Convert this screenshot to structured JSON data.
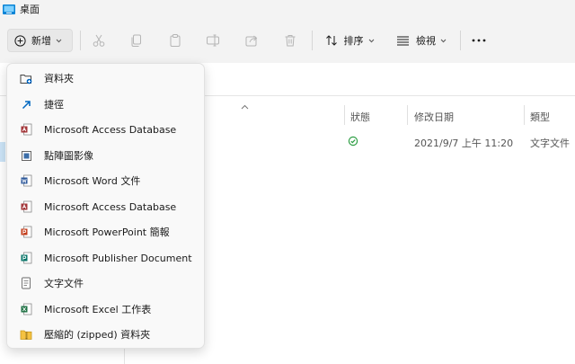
{
  "window": {
    "title": "桌面"
  },
  "toolbar": {
    "new_label": "新增",
    "sort_label": "排序",
    "view_label": "檢視"
  },
  "menu": {
    "items": [
      {
        "label": "資料夾",
        "icon": "folder-new-icon"
      },
      {
        "label": "捷徑",
        "icon": "shortcut-icon"
      },
      {
        "label": "Microsoft Access Database",
        "icon": "access-icon"
      },
      {
        "label": "點陣圖影像",
        "icon": "bitmap-icon"
      },
      {
        "label": "Microsoft Word 文件",
        "icon": "word-icon"
      },
      {
        "label": "Microsoft Access Database",
        "icon": "access-icon"
      },
      {
        "label": "Microsoft PowerPoint 簡報",
        "icon": "powerpoint-icon"
      },
      {
        "label": "Microsoft Publisher Document",
        "icon": "publisher-icon"
      },
      {
        "label": "文字文件",
        "icon": "text-document-icon"
      },
      {
        "label": "Microsoft Excel 工作表",
        "icon": "excel-icon"
      },
      {
        "label": "壓縮的 (zipped) 資料夾",
        "icon": "zip-folder-icon"
      }
    ]
  },
  "columns": {
    "status": "狀態",
    "modified": "修改日期",
    "type": "類型"
  },
  "file_row": {
    "modified": "2021/9/7 上午 11:20",
    "type": "文字文件"
  },
  "colors": {
    "accent": "#0067c0",
    "chrome": "#f3f3f3",
    "status_ok": "#2e9e44",
    "word": "#2b579a",
    "excel": "#217346",
    "powerpoint": "#c43e1c",
    "access": "#a4373a",
    "publisher": "#077568"
  }
}
